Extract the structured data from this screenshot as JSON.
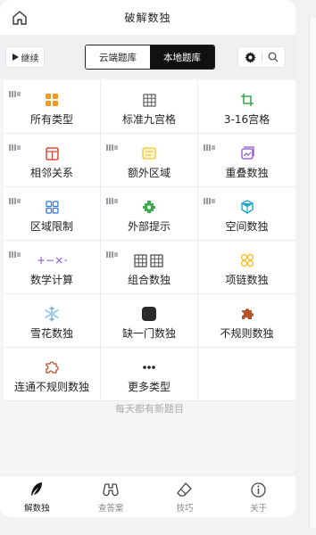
{
  "header": {
    "title": "破解数独"
  },
  "toolbar": {
    "continue_label": "继续",
    "cloud_tab": "云端题库",
    "local_tab": "本地题库"
  },
  "colors": {
    "orange": "#f39a1e",
    "green": "#3bab4b",
    "blue": "#2d7be0",
    "purple": "#8a4fd8",
    "pink": "#e43f7a",
    "teal": "#1aa6c8",
    "red": "#e2483a",
    "brown": "#b5532a",
    "yellow": "#f2c230"
  },
  "grid": [
    {
      "label": "所有类型",
      "icon": "four-squares-icon",
      "flag": true
    },
    {
      "label": "标准九宫格",
      "icon": "nine-grid-icon",
      "flag": false
    },
    {
      "label": "3-16宫格",
      "icon": "crop-icon",
      "flag": false
    },
    {
      "label": "相邻关系",
      "icon": "window-icon",
      "flag": true
    },
    {
      "label": "额外区域",
      "icon": "highlight-region-icon",
      "flag": true
    },
    {
      "label": "重叠数独",
      "icon": "overlap-icon",
      "flag": true
    },
    {
      "label": "区域限制",
      "icon": "region-grid-icon",
      "flag": true
    },
    {
      "label": "外部提示",
      "icon": "gear-puzzle-icon",
      "flag": true
    },
    {
      "label": "空间数独",
      "icon": "cube-icon",
      "flag": true
    },
    {
      "label": "数学计算",
      "icon": "math-icon",
      "flag": true
    },
    {
      "label": "组合数独",
      "icon": "double-grid-icon",
      "flag": true
    },
    {
      "label": "项链数独",
      "icon": "necklace-icon",
      "flag": false
    },
    {
      "label": "雪花数独",
      "icon": "snowflake-icon",
      "flag": false
    },
    {
      "label": "缺一门数独",
      "icon": "rounded-square-icon",
      "flag": false
    },
    {
      "label": "不规则数独",
      "icon": "puzzle-piece-icon",
      "flag": false
    },
    {
      "label": "连通不规则数独",
      "icon": "puzzle-outline-icon",
      "flag": false
    },
    {
      "label": "更多类型",
      "icon": "more-dots-icon",
      "flag": false
    }
  ],
  "footer_note": "每天都有新题目",
  "tabs": [
    {
      "label": "解数独",
      "icon": "feather-icon",
      "active": true
    },
    {
      "label": "查答案",
      "icon": "binoculars-icon",
      "active": false
    },
    {
      "label": "技巧",
      "icon": "eraser-icon",
      "active": false
    },
    {
      "label": "关于",
      "icon": "info-icon",
      "active": false
    }
  ]
}
